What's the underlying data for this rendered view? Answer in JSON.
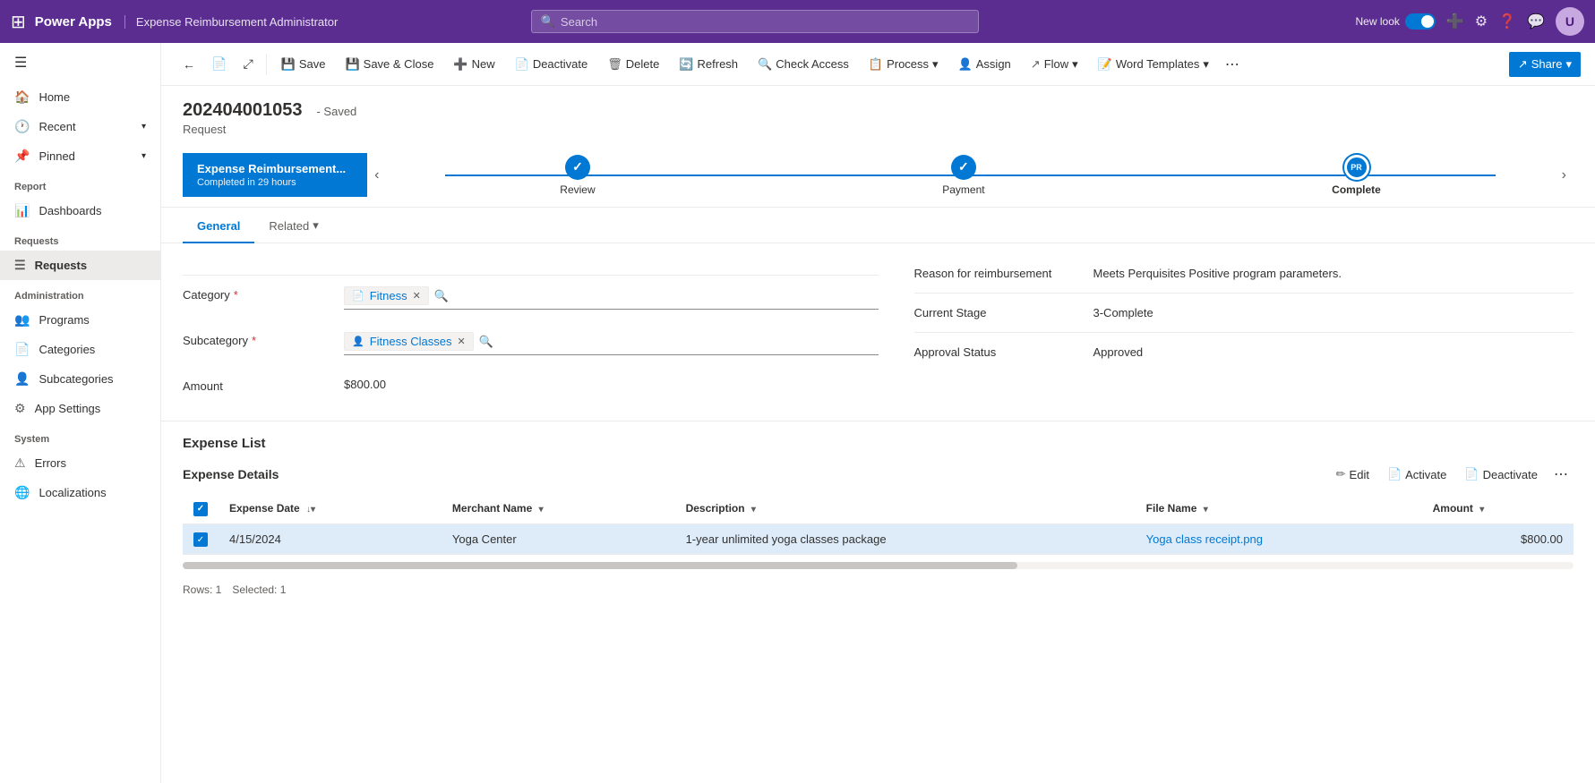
{
  "topnav": {
    "app_icon": "⊞",
    "app_name": "Power Apps",
    "app_page": "Expense Reimbursement Administrator",
    "search_placeholder": "Search",
    "new_look_label": "New look",
    "toggle_on": true
  },
  "toolbar": {
    "back_icon": "←",
    "doc_icon": "📄",
    "expand_icon": "⤢",
    "save_label": "Save",
    "save_close_label": "Save & Close",
    "new_label": "New",
    "deactivate_label": "Deactivate",
    "delete_label": "Delete",
    "refresh_label": "Refresh",
    "check_access_label": "Check Access",
    "process_label": "Process",
    "assign_label": "Assign",
    "flow_label": "Flow",
    "word_templates_label": "Word Templates",
    "share_label": "Share",
    "more_icon": "⋯"
  },
  "record": {
    "id": "202404001053",
    "saved_label": "- Saved",
    "type": "Request"
  },
  "stages": {
    "active_stage_name": "Expense Reimbursement...",
    "active_stage_subtitle": "Completed in 29 hours",
    "steps": [
      {
        "label": "Review",
        "icon": "✓",
        "completed": true,
        "current": false
      },
      {
        "label": "Payment",
        "icon": "✓",
        "completed": true,
        "current": false
      },
      {
        "label": "Complete",
        "icon": "PR",
        "completed": false,
        "current": true
      }
    ]
  },
  "tabs": {
    "general_label": "General",
    "related_label": "Related"
  },
  "form": {
    "left": {
      "category_label": "Category",
      "category_value": "Fitness",
      "category_icon": "📄",
      "subcategory_label": "Subcategory",
      "subcategory_value": "Fitness Classes",
      "subcategory_icon": "👤",
      "amount_label": "Amount",
      "amount_value": "$800.00"
    },
    "right": {
      "reason_label": "Reason for reimbursement",
      "reason_value": "Meets Perquisites Positive program parameters.",
      "current_stage_label": "Current Stage",
      "current_stage_value": "3-Complete",
      "approval_status_label": "Approval Status",
      "approval_status_value": "Approved"
    }
  },
  "expense_list": {
    "section_title": "Expense List",
    "table_title": "Expense Details",
    "actions": {
      "edit_label": "Edit",
      "activate_label": "Activate",
      "deactivate_label": "Deactivate",
      "more_icon": "⋯"
    },
    "columns": [
      {
        "label": "Expense Date",
        "sort": true
      },
      {
        "label": "Merchant Name",
        "sort": true
      },
      {
        "label": "Description",
        "sort": true
      },
      {
        "label": "File Name",
        "sort": true
      },
      {
        "label": "Amount",
        "sort": true
      }
    ],
    "rows": [
      {
        "selected": true,
        "expense_date": "4/15/2024",
        "merchant_name": "Yoga Center",
        "description": "1-year unlimited yoga classes package",
        "file_name": "Yoga class receipt.png",
        "amount": "$800.00"
      }
    ],
    "footer": {
      "rows_label": "Rows: 1",
      "selected_label": "Selected: 1"
    }
  },
  "sidebar": {
    "hamburger": "☰",
    "home_label": "Home",
    "recent_label": "Recent",
    "pinned_label": "Pinned",
    "report_section": "Report",
    "dashboards_label": "Dashboards",
    "requests_section": "Requests",
    "requests_label": "Requests",
    "administration_section": "Administration",
    "programs_label": "Programs",
    "categories_label": "Categories",
    "subcategories_label": "Subcategories",
    "app_settings_label": "App Settings",
    "system_section": "System",
    "errors_label": "Errors",
    "localizations_label": "Localizations"
  }
}
